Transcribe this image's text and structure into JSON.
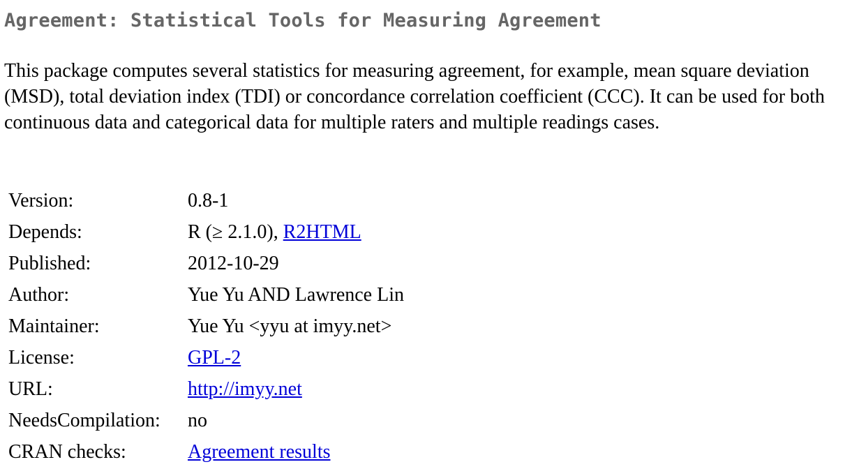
{
  "package": {
    "title": "Agreement: Statistical Tools for Measuring Agreement",
    "description": "This package computes several statistics for measuring agreement, for example, mean square deviation (MSD), total deviation index (TDI) or concordance correlation coefficient (CCC). It can be used for both continuous data and categorical data for multiple raters and multiple readings cases."
  },
  "details": {
    "version": {
      "label": "Version:",
      "value": "0.8-1"
    },
    "depends": {
      "label": "Depends:",
      "value_prefix": "R (≥ 2.1.0), ",
      "link": "R2HTML"
    },
    "published": {
      "label": "Published:",
      "value": "2012-10-29"
    },
    "author": {
      "label": "Author:",
      "value": "Yue Yu AND Lawrence Lin"
    },
    "maintainer": {
      "label": "Maintainer:",
      "value": "Yue Yu <yyu at imyy.net>"
    },
    "license": {
      "label": "License:",
      "link": "GPL-2"
    },
    "url": {
      "label": "URL:",
      "link": "http://imyy.net"
    },
    "needs_compilation": {
      "label": "NeedsCompilation:",
      "value": "no"
    },
    "cran_checks": {
      "label": "CRAN checks:",
      "link": "Agreement results"
    }
  },
  "colors": {
    "title": "#666666",
    "text": "#000000",
    "link": "#0000d8",
    "background": "#ffffff"
  }
}
